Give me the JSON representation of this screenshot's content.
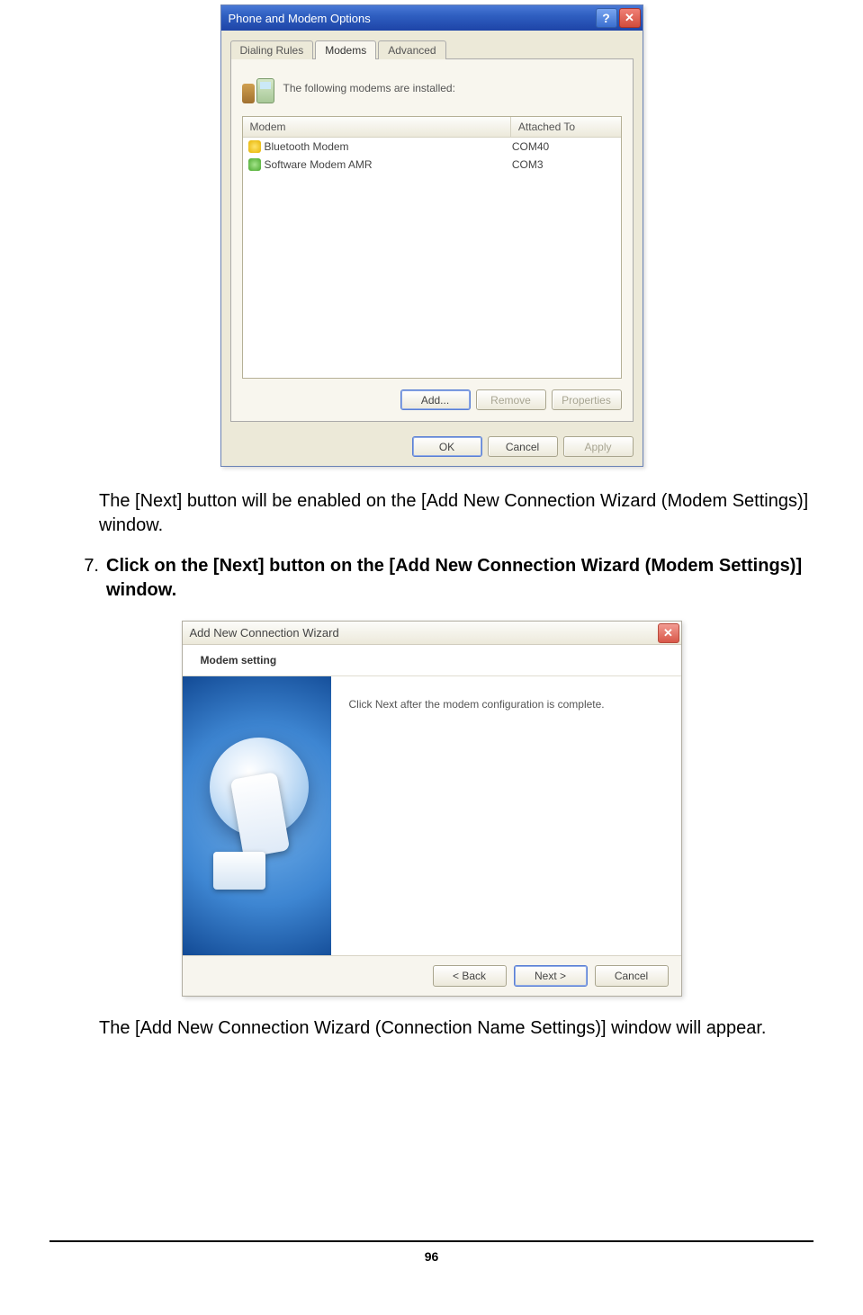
{
  "dialog1": {
    "title": "Phone and Modem Options",
    "tabs": [
      "Dialing Rules",
      "Modems",
      "Advanced"
    ],
    "active_tab_index": 1,
    "intro": "The following modems are installed:",
    "columns": {
      "modem": "Modem",
      "attached": "Attached To"
    },
    "rows": [
      {
        "name": "Bluetooth Modem",
        "port": "COM40"
      },
      {
        "name": "Software Modem AMR",
        "port": "COM3"
      }
    ],
    "pane_buttons": {
      "add": "Add...",
      "remove": "Remove",
      "properties": "Properties"
    },
    "footer_buttons": {
      "ok": "OK",
      "cancel": "Cancel",
      "apply": "Apply"
    }
  },
  "para1": "The [Next] button will be enabled on the [Add New Connection Wizard (Modem Settings)] window.",
  "step7": {
    "num": "7.",
    "text": "Click on the [Next] button on the [Add New Connection Wizard (Modem Settings)] window."
  },
  "dialog2": {
    "title": "Add New Connection Wizard",
    "subhead": "Modem setting",
    "content": "Click Next after the modem configuration is complete.",
    "buttons": {
      "back": "< Back",
      "next": "Next >",
      "cancel": "Cancel"
    }
  },
  "para2": "The [Add New Connection Wizard (Connection Name Settings)] window will appear.",
  "page_number": "96"
}
